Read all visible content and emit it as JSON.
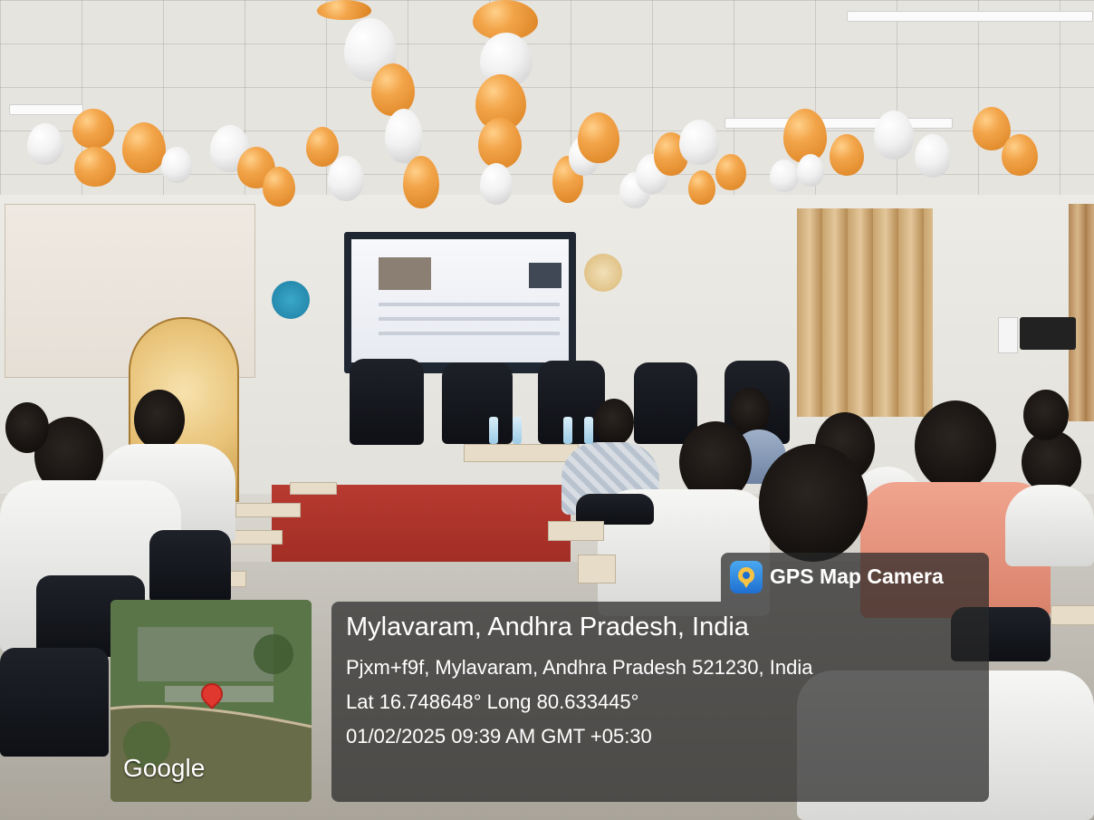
{
  "scene": {
    "description_visible": false
  },
  "overlay": {
    "brand": "GPS Map Camera",
    "brand_icon": "map-pin-camera-icon",
    "location_title": "Mylavaram, Andhra Pradesh, India",
    "address": "Pjxm+f9f, Mylavaram, Andhra Pradesh 521230, India",
    "coordinates": "Lat 16.748648° Long 80.633445°",
    "datetime": "01/02/2025 09:39 AM GMT +05:30",
    "map_provider": "Google",
    "pin_icon": "map-pin-icon",
    "panel_color": "#282828"
  }
}
